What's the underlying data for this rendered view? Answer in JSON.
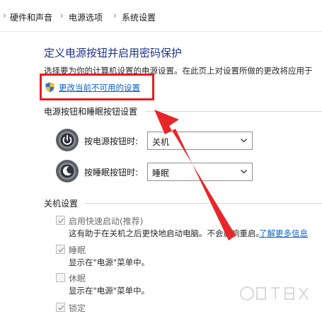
{
  "breadcrumb": {
    "items": [
      "硬件和声音",
      "电源选项",
      "系统设置"
    ],
    "separator": "›"
  },
  "page": {
    "title": "定义电源按钮并启用密码保护",
    "intro": "选择要为你的计算机设置的电源设置。在此页上对设置所做的更改将应用于",
    "change_link": "更改当前不可用的设置"
  },
  "power_section": {
    "heading": "电源按钮和睡眠按钮设置",
    "rows": [
      {
        "label": "按电源按钮时:",
        "value": "关机",
        "icon": "power-button-icon"
      },
      {
        "label": "按睡眠按钮时:",
        "value": "睡眠",
        "icon": "sleep-button-icon"
      }
    ]
  },
  "shutdown_section": {
    "heading": "关机设置",
    "options": [
      {
        "label": "启用快速启动(推荐)",
        "checked": true,
        "desc": "这有助于在关机之后更快地启动电脑。不会影响重启。",
        "link": "了解更多信息"
      },
      {
        "label": "睡眠",
        "checked": true,
        "desc": "显示在\"电源\"菜单中。"
      },
      {
        "label": "休眠",
        "checked": false,
        "desc": "显示在\"电源\"菜单中。"
      },
      {
        "label": "锁定",
        "checked": true
      }
    ]
  },
  "colors": {
    "title": "#1e3287",
    "link": "#0a62c9",
    "highlight": "#e41e20"
  }
}
